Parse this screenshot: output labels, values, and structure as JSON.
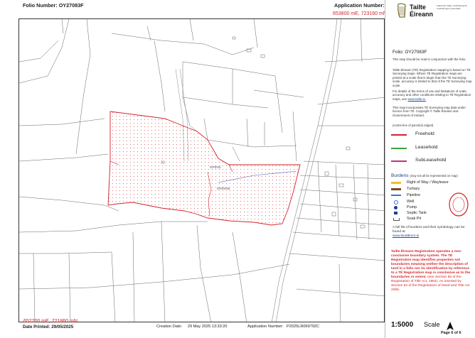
{
  "header": {
    "folio_label": "Folio Number: OY27083F",
    "application_label": "Application Number: P2025LR069792C"
  },
  "coords": {
    "top_right": "653800 mE, 723160 mN",
    "bottom_left": "652200 mE, 721860 mN"
  },
  "footer": {
    "date_printed": "Date Printed: 29/05/2025",
    "creation_date_label": "Creation Date:",
    "creation_date_value": "29 May 2025 13:33:20",
    "application_label": "Application Number:",
    "application_value": "P2025LR069792C"
  },
  "map": {
    "labels": {
      "oy_top": "OY0YG",
      "oy_mid": "OY0YHS",
      "label_a": "",
      "label_b": ""
    },
    "colors": {
      "freehold": "#d2232a",
      "boundary": "#555555",
      "road": "#9a9a9a"
    }
  },
  "panel": {
    "brand_name_1": "Tailte",
    "brand_name_2": "Éireann",
    "brand_sub": "Clárúchán Tailte, Suirbhéireacht, Luacháil agus Léarscáiliú",
    "folio": "Folio:   OY27083F",
    "p1": "This map should be read in conjunction with the folio.",
    "p2": "Tailte Éireann (TÉ) Registration mapping is based on TÉ Surveying maps. Where TÉ Registration maps are printed at a scale that is larger than the TÉ Surveying scale, accuracy is limited to that of the TÉ Surveying map scale.",
    "p3": "For details of the terms of use and limitations of scale, accuracy and other conditions relating to TÉ Registration maps, see",
    "p3_link": "www.tailte.ie.",
    "p4": "This map incorporates TÉ Surveying map data under licence from TÉ. Copyright © Tailte Éireann and Government of Ireland.",
    "edged_note": "(centre-line of parcel(s) edged)",
    "legend": [
      {
        "label": "Freehold",
        "color": "#d2232a"
      },
      {
        "label": "Leasehold",
        "color": "#3aa241"
      },
      {
        "label": "SubLeasehold",
        "color": "#c2307a"
      }
    ],
    "burdens_title": "Burdens",
    "burdens_note": "(may not all be represented on map)",
    "burdens": [
      {
        "label": "Right of Way / Wayleave",
        "icon": "yellow-line-icon",
        "color": "#f0c419"
      },
      {
        "label": "Turbary",
        "icon": "brown-line-icon",
        "color": "#7a4a1c"
      },
      {
        "label": "Pipeline",
        "icon": "blue-line-icon",
        "color": "#3b6fd1"
      },
      {
        "label": "Well",
        "icon": "well-circle-icon",
        "color": "#3b6fd1"
      },
      {
        "label": "Pump",
        "icon": "pump-dot-icon",
        "color": "#1d3f8a"
      },
      {
        "label": "Septic Tank",
        "icon": "septic-tank-icon",
        "color": "#1d3f8a"
      },
      {
        "label": "Soak Pit",
        "icon": "soak-pit-icon",
        "color": "#555555"
      }
    ],
    "full_list": "A full list of burdens and their symbology can be found at:",
    "full_list_link": "www.landdirect.ie",
    "disclaimer_bold": "Tailte Éireann Registration operates a non-conclusive boundary system. The TÉ Registration map identifies properties not boundaries meaning neither the description of land in a folio nor its identification by reference to a TÉ Registration map is conclusive as to the boundaries or extent.",
    "disclaimer_norm": "(see Section 85 of the Registration of Title Act, 1964). As inserted by Section 62 of the Registration of Deed and Title Act 2006.",
    "scale": "1:5000",
    "scale_label": "Scale",
    "page": "Page 6 of 6"
  }
}
